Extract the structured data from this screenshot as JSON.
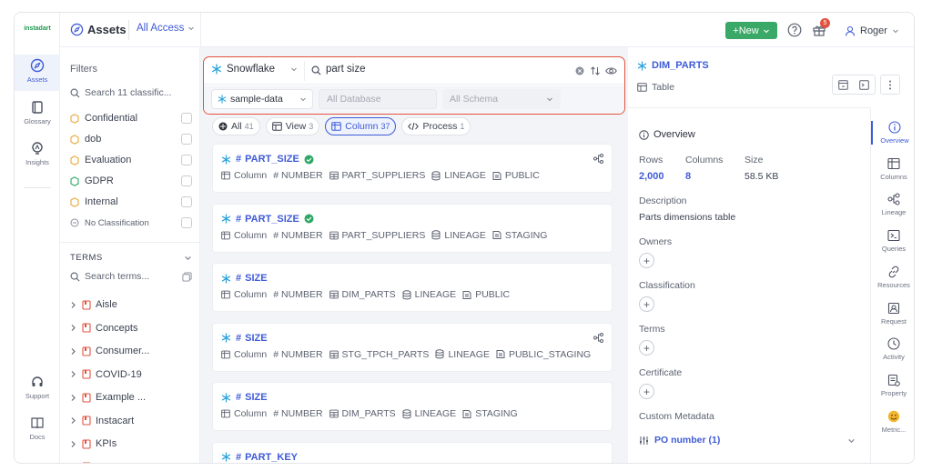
{
  "nav": {
    "logo": "instadart",
    "items": [
      {
        "label": "Assets",
        "icon": "compass-icon"
      },
      {
        "label": "Glossary",
        "icon": "book-icon"
      },
      {
        "label": "Insights",
        "icon": "bulb-icon"
      },
      {
        "label": "Support",
        "icon": "headset-icon"
      },
      {
        "label": "Docs",
        "icon": "docs-icon"
      }
    ]
  },
  "header": {
    "title": "Assets",
    "access": "All Access",
    "new_label": "+New",
    "badge_count": "5",
    "user": "Roger"
  },
  "search": {
    "connector": "Snowflake",
    "query": "part size",
    "database_selected": "sample-data",
    "database_placeholder": "All Database",
    "schema_placeholder": "All Schema"
  },
  "tabs": [
    {
      "label": "All",
      "count": "41"
    },
    {
      "label": "View",
      "count": "3"
    },
    {
      "label": "Column",
      "count": "37"
    },
    {
      "label": "Process",
      "count": "1"
    }
  ],
  "filters": {
    "title": "Filters",
    "search_placeholder": "Search 11 classific...",
    "classifications": [
      {
        "label": "Confidential",
        "color": "#e8a93b"
      },
      {
        "label": "dob",
        "color": "#e8a93b"
      },
      {
        "label": "Evaluation",
        "color": "#e8a93b"
      },
      {
        "label": "GDPR",
        "color": "#2fa866"
      },
      {
        "label": "Internal",
        "color": "#e8a93b"
      },
      {
        "label": "No Classification",
        "color": "#8a8f9c"
      }
    ],
    "terms_title": "TERMS",
    "terms_search": "Search terms...",
    "terms": [
      "Aisle",
      "Concepts",
      "Consumer...",
      "COVID-19",
      "Example ...",
      "Instacart",
      "KPIs",
      "Metrics"
    ]
  },
  "results": [
    {
      "name": "PART_SIZE",
      "verified": true,
      "type": "Column",
      "datatype": "NUMBER",
      "table": "PART_SUPPLIERS",
      "db": "LINEAGE",
      "schema": "PUBLIC",
      "lineage": true
    },
    {
      "name": "PART_SIZE",
      "verified": true,
      "type": "Column",
      "datatype": "NUMBER",
      "table": "PART_SUPPLIERS",
      "db": "LINEAGE",
      "schema": "STAGING",
      "lineage": false
    },
    {
      "name": "SIZE",
      "verified": false,
      "type": "Column",
      "datatype": "NUMBER",
      "table": "DIM_PARTS",
      "db": "LINEAGE",
      "schema": "PUBLIC",
      "lineage": false
    },
    {
      "name": "SIZE",
      "verified": false,
      "type": "Column",
      "datatype": "NUMBER",
      "table": "STG_TPCH_PARTS",
      "db": "LINEAGE",
      "schema": "PUBLIC_STAGING",
      "lineage": true
    },
    {
      "name": "SIZE",
      "verified": false,
      "type": "Column",
      "datatype": "NUMBER",
      "table": "DIM_PARTS",
      "db": "LINEAGE",
      "schema": "STAGING",
      "lineage": false
    },
    {
      "name": "PART_KEY",
      "verified": false,
      "type": "",
      "datatype": "",
      "table": "",
      "db": "",
      "schema": "",
      "lineage": false
    }
  ],
  "detail": {
    "name": "DIM_PARTS",
    "type": "Table",
    "overview_title": "Overview",
    "rows_label": "Rows",
    "rows": "2,000",
    "columns_label": "Columns",
    "columns": "8",
    "size_label": "Size",
    "size": "58.5 KB",
    "description_label": "Description",
    "description": "Parts dimensions table",
    "owners_label": "Owners",
    "classification_label": "Classification",
    "terms_label": "Terms",
    "certificate_label": "Certificate",
    "custom_metadata_label": "Custom Metadata",
    "po_number": "PO number (1)"
  },
  "right_tabs": [
    "Overview",
    "Columns",
    "Lineage",
    "Queries",
    "Resources",
    "Request",
    "Activity",
    "Property",
    "Metric..."
  ],
  "colors": {
    "accent": "#3f5bd8",
    "brand": "#1f9a54",
    "highlight": "#e0523f",
    "snowflake": "#29a3d9"
  }
}
